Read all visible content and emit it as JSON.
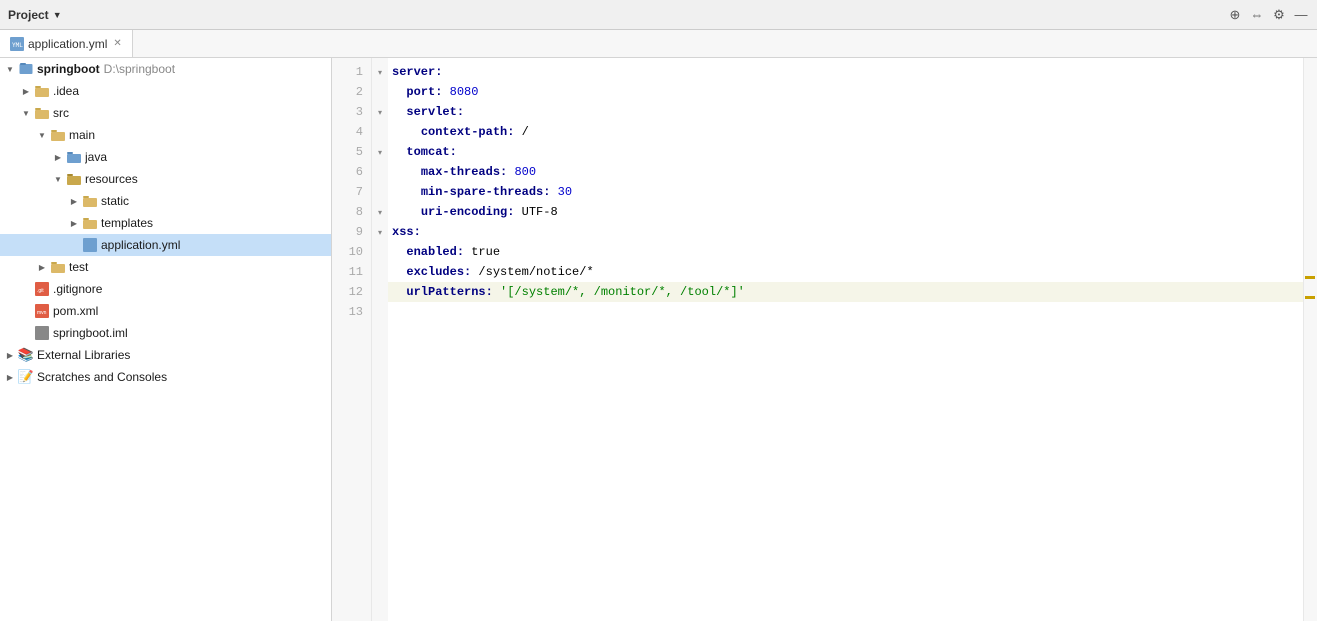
{
  "titleBar": {
    "projectLabel": "Project",
    "dropdownIcon": "chevron-down",
    "icons": [
      "add-content-icon",
      "horizontal-split-icon",
      "settings-icon",
      "close-icon"
    ]
  },
  "tab": {
    "filename": "application.yml",
    "icon": "yaml-file-icon",
    "closeIcon": "close-icon"
  },
  "sidebar": {
    "root": {
      "label": "springboot",
      "path": "D:\\springboot",
      "expanded": true
    },
    "items": [
      {
        "id": "idea",
        "label": ".idea",
        "indent": 1,
        "type": "folder",
        "expanded": false
      },
      {
        "id": "src",
        "label": "src",
        "indent": 1,
        "type": "folder",
        "expanded": true
      },
      {
        "id": "main",
        "label": "main",
        "indent": 2,
        "type": "folder",
        "expanded": true
      },
      {
        "id": "java",
        "label": "java",
        "indent": 3,
        "type": "folder-blue",
        "expanded": false
      },
      {
        "id": "resources",
        "label": "resources",
        "indent": 3,
        "type": "folder-res",
        "expanded": true
      },
      {
        "id": "static",
        "label": "static",
        "indent": 4,
        "type": "folder",
        "expanded": false
      },
      {
        "id": "templates",
        "label": "templates",
        "indent": 4,
        "type": "folder",
        "expanded": false
      },
      {
        "id": "application.yml",
        "label": "application.yml",
        "indent": 4,
        "type": "yaml",
        "selected": true
      },
      {
        "id": "test",
        "label": "test",
        "indent": 2,
        "type": "folder",
        "expanded": false
      },
      {
        "id": ".gitignore",
        "label": ".gitignore",
        "indent": 1,
        "type": "gitignore"
      },
      {
        "id": "pom.xml",
        "label": "pom.xml",
        "indent": 1,
        "type": "xml"
      },
      {
        "id": "springboot.iml",
        "label": "springboot.iml",
        "indent": 1,
        "type": "iml"
      },
      {
        "id": "external-libraries",
        "label": "External Libraries",
        "indent": 0,
        "type": "external",
        "expanded": false
      },
      {
        "id": "scratches",
        "label": "Scratches and Consoles",
        "indent": 0,
        "type": "scratch",
        "expanded": false
      }
    ]
  },
  "editor": {
    "lines": [
      {
        "num": 1,
        "fold": "open",
        "content": "server:",
        "tokens": [
          {
            "t": "k",
            "v": "server:"
          }
        ]
      },
      {
        "num": 2,
        "fold": "",
        "content": "  port: 8080",
        "tokens": [
          {
            "t": "n",
            "v": "  "
          },
          {
            "t": "k",
            "v": "port:"
          },
          {
            "t": "n",
            "v": " "
          },
          {
            "t": "num",
            "v": "8080"
          }
        ]
      },
      {
        "num": 3,
        "fold": "open",
        "content": "  servlet:",
        "tokens": [
          {
            "t": "n",
            "v": "  "
          },
          {
            "t": "k",
            "v": "servlet:"
          }
        ]
      },
      {
        "num": 4,
        "fold": "",
        "content": "    context-path: /",
        "tokens": [
          {
            "t": "n",
            "v": "    "
          },
          {
            "t": "k",
            "v": "context-path:"
          },
          {
            "t": "n",
            "v": " /"
          }
        ]
      },
      {
        "num": 5,
        "fold": "open",
        "content": "  tomcat:",
        "tokens": [
          {
            "t": "n",
            "v": "  "
          },
          {
            "t": "k",
            "v": "tomcat:"
          }
        ]
      },
      {
        "num": 6,
        "fold": "",
        "content": "    max-threads: 800",
        "tokens": [
          {
            "t": "n",
            "v": "    "
          },
          {
            "t": "k",
            "v": "max-threads:"
          },
          {
            "t": "n",
            "v": " "
          },
          {
            "t": "num",
            "v": "800"
          }
        ]
      },
      {
        "num": 7,
        "fold": "",
        "content": "    min-spare-threads: 30",
        "tokens": [
          {
            "t": "n",
            "v": "    "
          },
          {
            "t": "k",
            "v": "min-spare-threads:"
          },
          {
            "t": "n",
            "v": " "
          },
          {
            "t": "num",
            "v": "30"
          }
        ]
      },
      {
        "num": 8,
        "fold": "open",
        "content": "    uri-encoding: UTF-8",
        "tokens": [
          {
            "t": "n",
            "v": "    "
          },
          {
            "t": "k",
            "v": "uri-encoding:"
          },
          {
            "t": "n",
            "v": " UTF-8"
          }
        ]
      },
      {
        "num": 9,
        "fold": "open",
        "content": "xss:",
        "tokens": [
          {
            "t": "k",
            "v": "xss:"
          }
        ]
      },
      {
        "num": 10,
        "fold": "",
        "content": "  enabled: true",
        "tokens": [
          {
            "t": "n",
            "v": "  "
          },
          {
            "t": "k",
            "v": "enabled:"
          },
          {
            "t": "n",
            "v": " true"
          }
        ]
      },
      {
        "num": 11,
        "fold": "",
        "content": "  excludes: /system/notice/*",
        "tokens": [
          {
            "t": "n",
            "v": "  "
          },
          {
            "t": "k",
            "v": "excludes:"
          },
          {
            "t": "n",
            "v": " /system/notice/*"
          }
        ]
      },
      {
        "num": 12,
        "fold": "",
        "content": "  urlPatterns: '[/system/*, /monitor/*, /tool/*]'",
        "tokens": [
          {
            "t": "n",
            "v": "  "
          },
          {
            "t": "k",
            "v": "urlPatterns:"
          },
          {
            "t": "n",
            "v": " "
          },
          {
            "t": "s",
            "v": "'[/system/*, /monitor/*, /tool/*]'"
          }
        ],
        "highlighted": true
      },
      {
        "num": 13,
        "fold": "",
        "content": "",
        "tokens": []
      }
    ]
  },
  "rightMargin": {
    "markers": [
      218,
      238
    ]
  }
}
